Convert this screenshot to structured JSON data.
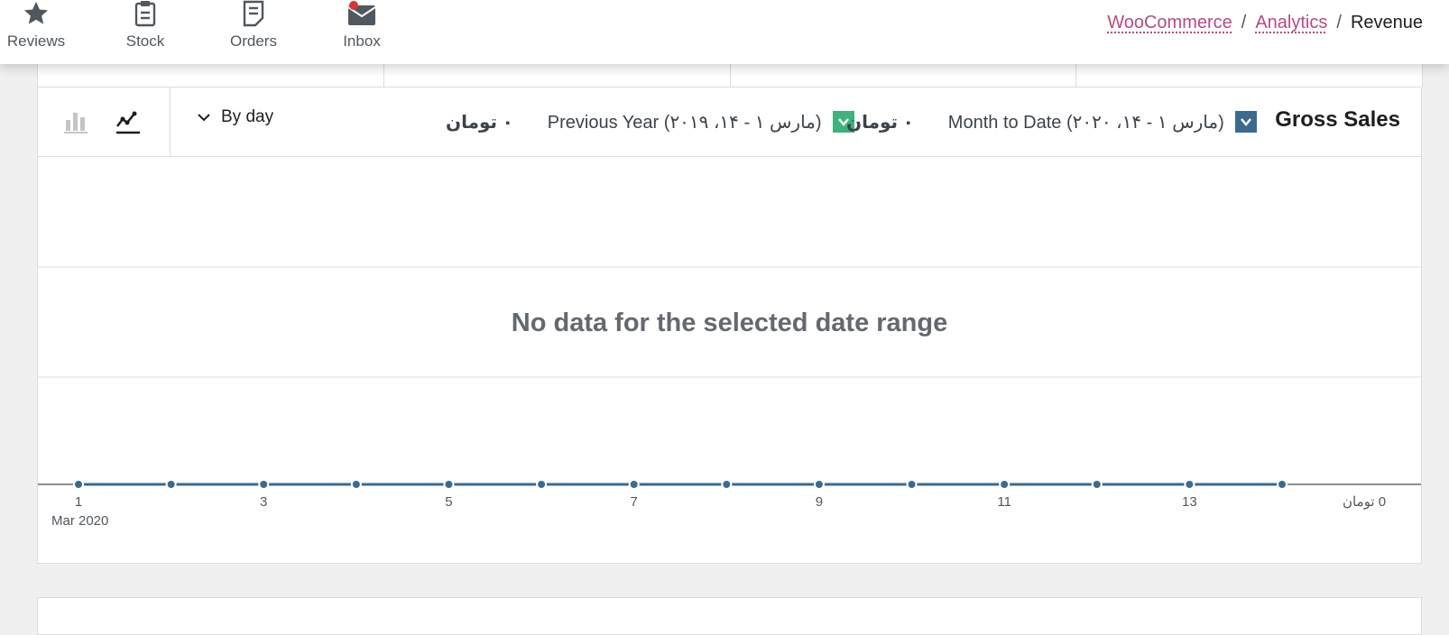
{
  "nav": {
    "items": [
      {
        "label": "Reviews",
        "icon": "star-icon"
      },
      {
        "label": "Stock",
        "icon": "clipboard-icon"
      },
      {
        "label": "Orders",
        "icon": "document-icon"
      },
      {
        "label": "Inbox",
        "icon": "mail-icon"
      }
    ]
  },
  "breadcrumb": {
    "items": [
      "WooCommerce",
      "Analytics"
    ],
    "current": "Revenue",
    "separator": "/"
  },
  "panel": {
    "title": "Gross Sales",
    "interval": "By day",
    "legend": [
      {
        "label": "Month to Date (مارس ۱ - ۱۴، ۲۰۲۰)",
        "value": "۰ تومان",
        "color": "#3b6a8f"
      },
      {
        "label": "Previous Year (مارس ۱ - ۱۴، ۲۰۱۹)",
        "value": "۰ تومان",
        "color": "#3bb37a"
      }
    ],
    "no_data": "No data for the selected date range"
  },
  "colors": {
    "accent": "#b54a82",
    "series_primary": "#3b6a8f",
    "series_secondary": "#3bb37a",
    "badge": "#d63638"
  },
  "chart_data": {
    "type": "line",
    "x": [
      1,
      2,
      3,
      4,
      5,
      6,
      7,
      8,
      9,
      10,
      11,
      12,
      13,
      14
    ],
    "series": [
      {
        "name": "Month to Date (مارس ۱ - ۱۴، ۲۰۲۰)",
        "values": [
          0,
          0,
          0,
          0,
          0,
          0,
          0,
          0,
          0,
          0,
          0,
          0,
          0,
          0
        ]
      }
    ],
    "x_tick_labels": [
      "1",
      "3",
      "5",
      "7",
      "9",
      "11",
      "13"
    ],
    "x_subtitle": "Mar 2020",
    "y_tick_label": "0 تومان",
    "grid": true
  }
}
